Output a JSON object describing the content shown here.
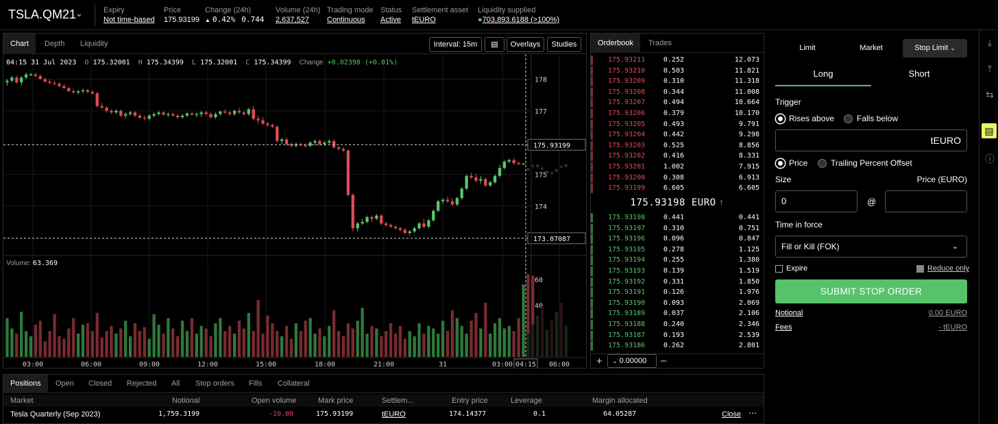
{
  "header": {
    "market": "TSLA.QM21",
    "stats": [
      {
        "label": "Expiry",
        "value": "Not time-based"
      },
      {
        "label": "Price",
        "value": "175.93199"
      },
      {
        "label": "Change (24h)",
        "value": "0.42%",
        "value2": "0.744"
      },
      {
        "label": "Volume (24h)",
        "value": "2,637,527"
      },
      {
        "label": "Trading mode",
        "value": "Continuous"
      },
      {
        "label": "Status",
        "value": "Active"
      },
      {
        "label": "Settlement asset",
        "value": "tEURO"
      },
      {
        "label": "Liquidity supplied",
        "value": "703,893.6188 (>100%)"
      }
    ]
  },
  "chart_tabs": [
    "Chart",
    "Depth",
    "Liquidity"
  ],
  "chart_toolbar": {
    "interval": "Interval: 15m",
    "overlays": "Overlays",
    "studies": "Studies"
  },
  "ohlc": {
    "time": "04:15 31 Jul 2023",
    "o_label": "O",
    "o": "175.32001",
    "h_label": "H",
    "h": "175.34399",
    "l_label": "L",
    "l": "175.32001",
    "c_label": "C",
    "c": "175.34399",
    "change_label": "Change",
    "change": "+0.02398 (+0.01%)"
  },
  "volume_label": "Volume:",
  "volume_value": "63.369",
  "chart_data": {
    "type": "candlestick",
    "price_axis": [
      "178",
      "177",
      "175",
      "174"
    ],
    "volume_axis": [
      "60",
      "40"
    ],
    "time_axis": [
      "03:00",
      "06:00",
      "09:00",
      "12:00",
      "15:00",
      "18:00",
      "21:00",
      "31",
      "03:00",
      "04:15",
      "06:00"
    ],
    "crosshair_price": "175.93199",
    "low_marker": "173.07087",
    "ylim": [
      172.7,
      178.4
    ],
    "colors": {
      "up": "#5ac569",
      "down": "#e04b56"
    },
    "candles": [
      [
        177.9,
        178.0,
        177.8,
        177.95
      ],
      [
        177.95,
        178.1,
        177.9,
        178.05
      ],
      [
        178.05,
        178.1,
        177.85,
        177.9
      ],
      [
        177.9,
        178.1,
        177.8,
        178.05
      ],
      [
        178.05,
        178.2,
        178.0,
        178.15
      ],
      [
        178.15,
        178.2,
        178.1,
        178.15
      ],
      [
        178.15,
        178.2,
        178.05,
        178.1
      ],
      [
        178.1,
        178.15,
        178.0,
        178.0
      ],
      [
        178.0,
        178.05,
        177.9,
        177.92
      ],
      [
        177.92,
        178.0,
        177.85,
        177.88
      ],
      [
        177.88,
        177.95,
        177.8,
        177.85
      ],
      [
        177.85,
        177.9,
        177.75,
        177.78
      ],
      [
        177.78,
        177.85,
        177.7,
        177.72
      ],
      [
        177.72,
        177.75,
        177.6,
        177.62
      ],
      [
        177.62,
        177.7,
        177.55,
        177.58
      ],
      [
        177.58,
        177.65,
        177.52,
        177.62
      ],
      [
        177.62,
        177.7,
        177.55,
        177.65
      ],
      [
        177.65,
        177.7,
        177.55,
        177.6
      ],
      [
        177.6,
        177.65,
        177.5,
        177.55
      ],
      [
        177.55,
        177.6,
        177.1,
        177.15
      ],
      [
        177.15,
        177.25,
        177.05,
        177.1
      ],
      [
        177.1,
        177.15,
        176.95,
        177.0
      ],
      [
        177.0,
        177.05,
        176.9,
        176.95
      ],
      [
        176.95,
        177.05,
        176.9,
        177.0
      ],
      [
        177.0,
        177.05,
        176.8,
        176.85
      ],
      [
        176.85,
        176.95,
        176.75,
        176.9
      ],
      [
        176.9,
        177.0,
        176.85,
        176.95
      ],
      [
        176.95,
        177.0,
        176.8,
        176.85
      ],
      [
        176.85,
        176.9,
        176.75,
        176.78
      ],
      [
        176.78,
        176.85,
        176.7,
        176.75
      ],
      [
        176.75,
        176.9,
        176.7,
        176.85
      ],
      [
        176.85,
        176.95,
        176.8,
        176.9
      ],
      [
        176.9,
        177.0,
        176.85,
        176.95
      ],
      [
        176.95,
        177.0,
        176.85,
        176.88
      ],
      [
        176.88,
        176.95,
        176.8,
        176.9
      ],
      [
        176.9,
        176.95,
        176.82,
        176.85
      ],
      [
        176.85,
        176.9,
        176.75,
        176.8
      ],
      [
        176.8,
        176.9,
        176.75,
        176.85
      ],
      [
        176.85,
        176.95,
        176.8,
        176.92
      ],
      [
        176.92,
        176.95,
        176.85,
        176.88
      ],
      [
        176.88,
        176.95,
        176.8,
        176.9
      ],
      [
        176.9,
        177.0,
        176.8,
        176.95
      ],
      [
        176.95,
        177.0,
        176.85,
        176.9
      ],
      [
        176.9,
        176.95,
        176.75,
        176.8
      ],
      [
        176.8,
        176.95,
        176.75,
        176.9
      ],
      [
        176.9,
        177.0,
        176.85,
        176.98
      ],
      [
        176.98,
        177.05,
        176.9,
        176.95
      ],
      [
        176.95,
        177.0,
        176.85,
        176.9
      ],
      [
        176.9,
        177.05,
        176.85,
        177.0
      ],
      [
        177.0,
        177.1,
        176.9,
        176.95
      ],
      [
        176.95,
        177.0,
        176.85,
        176.9
      ],
      [
        176.9,
        177.1,
        176.85,
        177.05
      ],
      [
        177.05,
        177.15,
        176.7,
        176.75
      ],
      [
        176.75,
        176.85,
        176.6,
        176.7
      ],
      [
        176.7,
        176.8,
        176.55,
        176.6
      ],
      [
        176.6,
        176.65,
        176.5,
        176.55
      ],
      [
        176.55,
        176.6,
        176.45,
        176.5
      ],
      [
        176.5,
        176.55,
        176.0,
        176.05
      ],
      [
        176.05,
        176.15,
        175.95,
        176.1
      ],
      [
        176.1,
        176.15,
        175.9,
        175.95
      ],
      [
        175.95,
        176.0,
        175.85,
        175.9
      ],
      [
        175.9,
        176.0,
        175.85,
        175.95
      ],
      [
        175.95,
        176.0,
        175.88,
        175.92
      ],
      [
        175.92,
        175.98,
        175.85,
        175.9
      ],
      [
        175.9,
        176.05,
        175.85,
        176.0
      ],
      [
        176.0,
        176.1,
        175.9,
        176.05
      ],
      [
        176.05,
        176.1,
        175.9,
        175.95
      ],
      [
        175.95,
        176.05,
        175.9,
        176.0
      ],
      [
        176.0,
        176.1,
        175.95,
        176.05
      ],
      [
        176.05,
        176.1,
        175.8,
        175.85
      ],
      [
        175.85,
        175.9,
        175.75,
        175.8
      ],
      [
        175.8,
        175.85,
        175.7,
        175.75
      ],
      [
        175.75,
        175.78,
        174.3,
        174.35
      ],
      [
        174.35,
        174.4,
        173.2,
        173.3
      ],
      [
        173.3,
        173.5,
        173.2,
        173.45
      ],
      [
        173.45,
        173.6,
        173.4,
        173.5
      ],
      [
        173.5,
        173.7,
        173.45,
        173.65
      ],
      [
        173.65,
        173.7,
        173.5,
        173.6
      ],
      [
        173.6,
        173.75,
        173.55,
        173.7
      ],
      [
        173.7,
        173.75,
        173.4,
        173.45
      ],
      [
        173.45,
        173.5,
        173.35,
        173.4
      ],
      [
        173.4,
        173.45,
        173.3,
        173.35
      ],
      [
        173.35,
        173.4,
        173.25,
        173.3
      ],
      [
        173.3,
        173.35,
        173.2,
        173.25
      ],
      [
        173.25,
        173.3,
        173.1,
        173.15
      ],
      [
        173.15,
        173.25,
        173.07,
        173.2
      ],
      [
        173.2,
        173.35,
        173.15,
        173.3
      ],
      [
        173.3,
        173.5,
        173.25,
        173.45
      ],
      [
        173.45,
        173.6,
        173.3,
        173.35
      ],
      [
        173.35,
        173.6,
        173.3,
        173.55
      ],
      [
        173.55,
        173.9,
        173.5,
        173.85
      ],
      [
        173.85,
        174.2,
        173.8,
        174.15
      ],
      [
        174.15,
        174.25,
        174.05,
        174.2
      ],
      [
        174.2,
        174.3,
        174.1,
        174.15
      ],
      [
        174.15,
        174.25,
        174.0,
        174.05
      ],
      [
        174.05,
        174.3,
        174.0,
        174.25
      ],
      [
        174.25,
        174.6,
        174.2,
        174.55
      ],
      [
        174.55,
        175.0,
        174.5,
        174.95
      ],
      [
        174.95,
        175.05,
        174.85,
        174.9
      ],
      [
        174.9,
        175.0,
        174.75,
        174.8
      ],
      [
        174.8,
        174.95,
        174.7,
        174.85
      ],
      [
        174.85,
        174.9,
        174.6,
        174.65
      ],
      [
        174.65,
        174.8,
        174.6,
        174.75
      ],
      [
        174.75,
        175.0,
        174.7,
        174.95
      ],
      [
        174.95,
        175.3,
        174.9,
        175.2
      ],
      [
        175.2,
        175.45,
        175.15,
        175.4
      ],
      [
        175.4,
        175.5,
        175.35,
        175.45
      ],
      [
        175.45,
        175.5,
        175.3,
        175.35
      ],
      [
        175.35,
        175.4,
        175.3,
        175.32
      ],
      [
        175.32,
        175.35,
        175.3,
        175.34
      ]
    ],
    "volumes": [
      30,
      22,
      18,
      35,
      20,
      16,
      25,
      28,
      12,
      20,
      33,
      16,
      14,
      22,
      30,
      18,
      25,
      26,
      20,
      34,
      15,
      20,
      24,
      18,
      22,
      28,
      16,
      26,
      20,
      23,
      14,
      33,
      25,
      18,
      30,
      22,
      16,
      28,
      20,
      30,
      18,
      24,
      22,
      16,
      26,
      30,
      20,
      24,
      18,
      28,
      22,
      34,
      20,
      44,
      18,
      32,
      26,
      20,
      16,
      24,
      14,
      26,
      20,
      28,
      30,
      18,
      22,
      16,
      24,
      36,
      20,
      16,
      26,
      22,
      28,
      38,
      18,
      24,
      22,
      16,
      20,
      26,
      18,
      24,
      14,
      20,
      16,
      26,
      18,
      24,
      22,
      18,
      28,
      20,
      36,
      30,
      24,
      18,
      28,
      34,
      22,
      42,
      18,
      26,
      30,
      22,
      24,
      20,
      30,
      56,
      64,
      63
    ]
  },
  "orderbook": {
    "tabs": [
      "Orderbook",
      "Trades"
    ],
    "asks": [
      [
        "175.93211",
        "0.252",
        "12.073"
      ],
      [
        "175.93210",
        "0.503",
        "11.821"
      ],
      [
        "175.93209",
        "0.310",
        "11.318"
      ],
      [
        "175.93208",
        "0.344",
        "11.008"
      ],
      [
        "175.93207",
        "0.494",
        "10.664"
      ],
      [
        "175.93206",
        "0.379",
        "10.170"
      ],
      [
        "175.93205",
        "0.493",
        "9.791"
      ],
      [
        "175.93204",
        "0.442",
        "9.298"
      ],
      [
        "175.93203",
        "0.525",
        "8.856"
      ],
      [
        "175.93202",
        "0.416",
        "8.331"
      ],
      [
        "175.93201",
        "1.002",
        "7.915"
      ],
      [
        "175.93200",
        "0.308",
        "6.913"
      ],
      [
        "175.93199",
        "6.605",
        "6.605"
      ]
    ],
    "mid": "175.93198 EURO",
    "bids": [
      [
        "175.93198",
        "0.441",
        "0.441"
      ],
      [
        "175.93197",
        "0.310",
        "0.751"
      ],
      [
        "175.93196",
        "0.096",
        "0.847"
      ],
      [
        "175.93195",
        "0.278",
        "1.125"
      ],
      [
        "175.93194",
        "0.255",
        "1.380"
      ],
      [
        "175.93193",
        "0.139",
        "1.519"
      ],
      [
        "175.93192",
        "0.331",
        "1.850"
      ],
      [
        "175.93191",
        "0.126",
        "1.976"
      ],
      [
        "175.93190",
        "0.093",
        "2.069"
      ],
      [
        "175.93189",
        "0.037",
        "2.106"
      ],
      [
        "175.93188",
        "0.240",
        "2.346"
      ],
      [
        "175.93187",
        "0.193",
        "2.539"
      ],
      [
        "175.93186",
        "0.262",
        "2.801"
      ]
    ],
    "resolution": "0.00000"
  },
  "ticket": {
    "types": [
      "Limit",
      "Market",
      "Stop Limit"
    ],
    "sides": [
      "Long",
      "Short"
    ],
    "trigger_label": "Trigger",
    "rises_above": "Rises above",
    "falls_below": "Falls below",
    "trigger_unit": "tEURO",
    "price_opt": "Price",
    "trailing_opt": "Trailing Percent Offset",
    "size_label": "Size",
    "price_label": "Price (EURO)",
    "size_value": "0",
    "at": "@",
    "tif_label": "Time in force",
    "tif_value": "Fill or Kill (FOK)",
    "expire": "Expire",
    "reduce_only": "Reduce only",
    "submit": "SUBMIT STOP ORDER",
    "notional_label": "Notional",
    "notional_value": "0.00 EURO",
    "fees_label": "Fees",
    "fees_value": "- tEURO"
  },
  "positions": {
    "tabs": [
      "Positions",
      "Open",
      "Closed",
      "Rejected",
      "All",
      "Stop orders",
      "Fills",
      "Collateral"
    ],
    "headers": [
      "Market",
      "Notional",
      "Open volume",
      "Mark price",
      "Settlem...",
      "Entry price",
      "Leverage",
      "Margin allocated"
    ],
    "row": {
      "market": "Tesla Quarterly (Sep 2023)",
      "notional": "1,759.3199",
      "open_volume": "-10.00",
      "mark_price": "175.93199",
      "settlement": "tEURO",
      "entry_price": "174.14377",
      "leverage": "0.1",
      "margin": "64.05287",
      "close": "Close"
    }
  }
}
